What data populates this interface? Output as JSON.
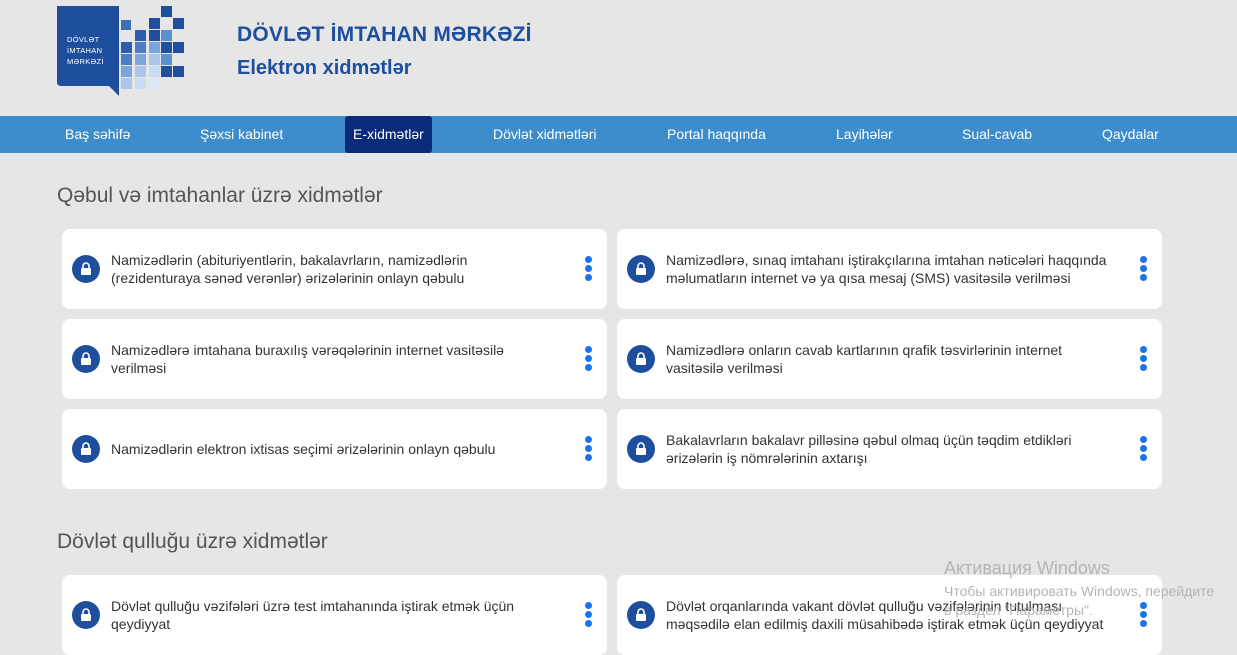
{
  "header": {
    "logo_lines": [
      "DÖVLƏT",
      "İMTAHAN",
      "MƏRKƏZİ"
    ],
    "title": "DÖVLƏT İMTAHAN MƏRKƏZİ",
    "subtitle": "Elektron xidmətlər"
  },
  "nav": {
    "items": [
      {
        "label": "Baş səhifə"
      },
      {
        "label": "Şəxsi kabinet"
      },
      {
        "label": "E-xidmətlər",
        "active": true
      },
      {
        "label": "Dövlət xidmətləri"
      },
      {
        "label": "Portal haqqında"
      },
      {
        "label": "Layihələr"
      },
      {
        "label": "Sual-cavab"
      },
      {
        "label": "Qaydalar"
      }
    ]
  },
  "sections": [
    {
      "title": "Qəbul və imtahanlar üzrə xidmətlər",
      "cards": [
        {
          "text": "Namizədlərin (abituriyentlərin, bakalavrların, namizədlərin (rezidenturaya sənəd verənlər) ərizələrinin onlayn qəbulu"
        },
        {
          "text": "Namizədlərə, sınaq imtahanı iştirakçılarına imtahan nəticələri haqqında məlumatların internet və ya qısa mesaj (SMS) vasitəsilə verilməsi"
        },
        {
          "text": "Namizədlərə imtahana buraxılış vərəqələrinin internet vasitəsilə verilməsi"
        },
        {
          "text": "Namizədlərə onların cavab kartlarının qrafik təsvirlərinin internet vasitəsilə verilməsi"
        },
        {
          "text": "Namizədlərin elektron ixtisas seçimi ərizələrinin onlayn qəbulu"
        },
        {
          "text": "Bakalavrların bakalavr pilləsinə qəbul olmaq üçün təqdim etdikləri ərizələrin iş nömrələrinin axtarışı"
        }
      ]
    },
    {
      "title": "Dövlət qulluğu üzrə xidmətlər",
      "cards": [
        {
          "text": "Dövlət qulluğu vəzifələri üzrə test imtahanında iştirak etmək üçün qeydiyyat"
        },
        {
          "text": "Dövlət orqanlarında vakant dövlət qulluğu vəzifələrinin tutulması məqsədilə elan edilmiş daxili müsahibədə iştirak etmək üçün qeydiyyat"
        }
      ]
    }
  ],
  "watermark": {
    "title": "Активация Windows",
    "line1": "Чтобы активировать Windows, перейдите",
    "line2": "в раздел \"Параметры\"."
  },
  "colors": {
    "brand": "#1d4f9e",
    "nav_bg": "#3d8ccc",
    "nav_active": "#0a2a7a",
    "kebab": "#1a73e8",
    "page_bg": "#e6e6e6"
  },
  "icons": {
    "lock": "lock-icon",
    "menu": "kebab-menu-icon"
  }
}
